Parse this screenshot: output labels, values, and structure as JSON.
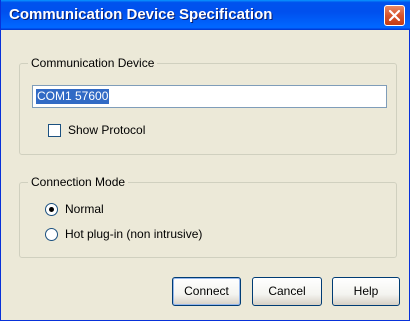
{
  "window": {
    "title": "Communication Device Specification"
  },
  "device_group": {
    "legend": "Communication Device",
    "device_value": "COM1 57600",
    "show_protocol_label": "Show Protocol",
    "show_protocol_checked": false
  },
  "mode_group": {
    "legend": "Connection Mode",
    "options": [
      {
        "label": "Normal",
        "selected": true
      },
      {
        "label": "Hot plug-in (non intrusive)",
        "selected": false
      }
    ]
  },
  "buttons": {
    "connect": "Connect",
    "cancel": "Cancel",
    "help": "Help"
  }
}
